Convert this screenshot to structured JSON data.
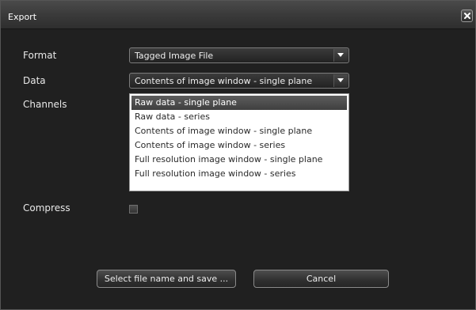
{
  "window": {
    "title": "Export",
    "close_icon": "close-icon"
  },
  "form": {
    "format": {
      "label": "Format",
      "value": "Tagged Image File"
    },
    "data": {
      "label": "Data",
      "value": "Contents of image window - single plane",
      "options": [
        "Raw data - single plane",
        "Raw data - series",
        "Contents of image window - single plane",
        "Contents of image window - series",
        "Full resolution image window - single plane",
        "Full resolution image window - series"
      ],
      "highlighted_option": "Raw data - single plane"
    },
    "channels": {
      "label": "Channels"
    },
    "compress": {
      "label": "Compress",
      "checked": false
    }
  },
  "buttons": {
    "save_label": "Select file name and save ...",
    "cancel_label": "Cancel"
  },
  "colors": {
    "background": "#202020",
    "titlebar": "#393939",
    "text": "#e8e8e8",
    "selection": "#4a4a4a"
  }
}
